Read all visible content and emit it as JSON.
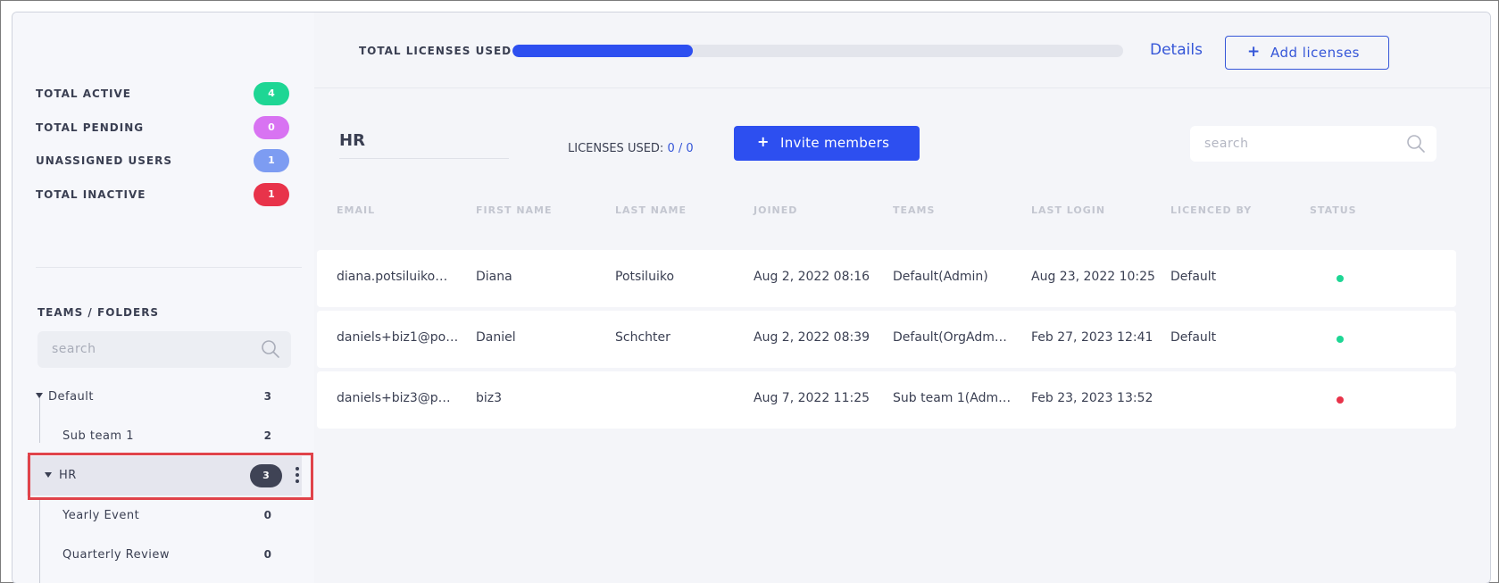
{
  "colors": {
    "accent": "#2d4ff0",
    "active": "#1ed694",
    "pending": "#d873f2",
    "unassigned": "#7d9cf2",
    "inactive": "#e8334a",
    "status_green": "#1ed694",
    "status_red": "#e8334a",
    "highlight_border": "#e0434a"
  },
  "stats": [
    {
      "label": "TOTAL ACTIVE",
      "value": "4",
      "color": "#1ed694"
    },
    {
      "label": "TOTAL PENDING",
      "value": "0",
      "color": "#d873f2"
    },
    {
      "label": "UNASSIGNED USERS",
      "value": "1",
      "color": "#7d9cf2"
    },
    {
      "label": "TOTAL INACTIVE",
      "value": "1",
      "color": "#e8334a"
    }
  ],
  "sidebar": {
    "section_title": "TEAMS / FOLDERS",
    "search_placeholder": "search",
    "search_icon": "search-icon",
    "tree": {
      "default": {
        "label": "Default",
        "count": "3"
      },
      "sub_team_1": {
        "label": "Sub team 1",
        "count": "2"
      },
      "hr": {
        "label": "HR",
        "count": "3"
      },
      "yearly_event": {
        "label": "Yearly Event",
        "count": "0"
      },
      "quarterly_review": {
        "label": "Quarterly Review",
        "count": "0"
      }
    }
  },
  "licenses": {
    "label": "TOTAL LICENSES USED",
    "progress_fraction": 0.295,
    "details_label": "Details",
    "add_label": "Add licenses",
    "add_icon": "plus-icon"
  },
  "team": {
    "name": "HR",
    "licenses_used_label": "LICENSES USED:",
    "licenses_used_value": "0 / 0",
    "invite_label": "Invite members",
    "invite_icon": "plus-icon",
    "search_placeholder": "search"
  },
  "table": {
    "columns": [
      "EMAIL",
      "FIRST NAME",
      "LAST NAME",
      "JOINED",
      "TEAMS",
      "LAST LOGIN",
      "LICENCED BY",
      "STATUS"
    ],
    "rows": [
      {
        "email": "diana.potsiluiko…",
        "first": "Diana",
        "last": "Potsiluiko",
        "joined": "Aug 2, 2022 08:16",
        "teams": "Default(Admin)",
        "last_login": "Aug 23, 2022 10:25",
        "licenced_by": "Default",
        "status": "active",
        "status_color": "#1ed694"
      },
      {
        "email": "daniels+biz1@po…",
        "first": "Daniel",
        "last": "Schchter",
        "joined": "Aug 2, 2022 08:39",
        "teams": "Default(OrgAdm…",
        "last_login": "Feb 27, 2023 12:41",
        "licenced_by": "Default",
        "status": "active",
        "status_color": "#1ed694"
      },
      {
        "email": "daniels+biz3@p…",
        "first": "biz3",
        "last": "",
        "joined": "Aug 7, 2022 11:25",
        "teams": "Sub team 1(Adm…",
        "last_login": "Feb 23, 2023 13:52",
        "licenced_by": "",
        "status": "inactive",
        "status_color": "#e8334a"
      }
    ]
  }
}
